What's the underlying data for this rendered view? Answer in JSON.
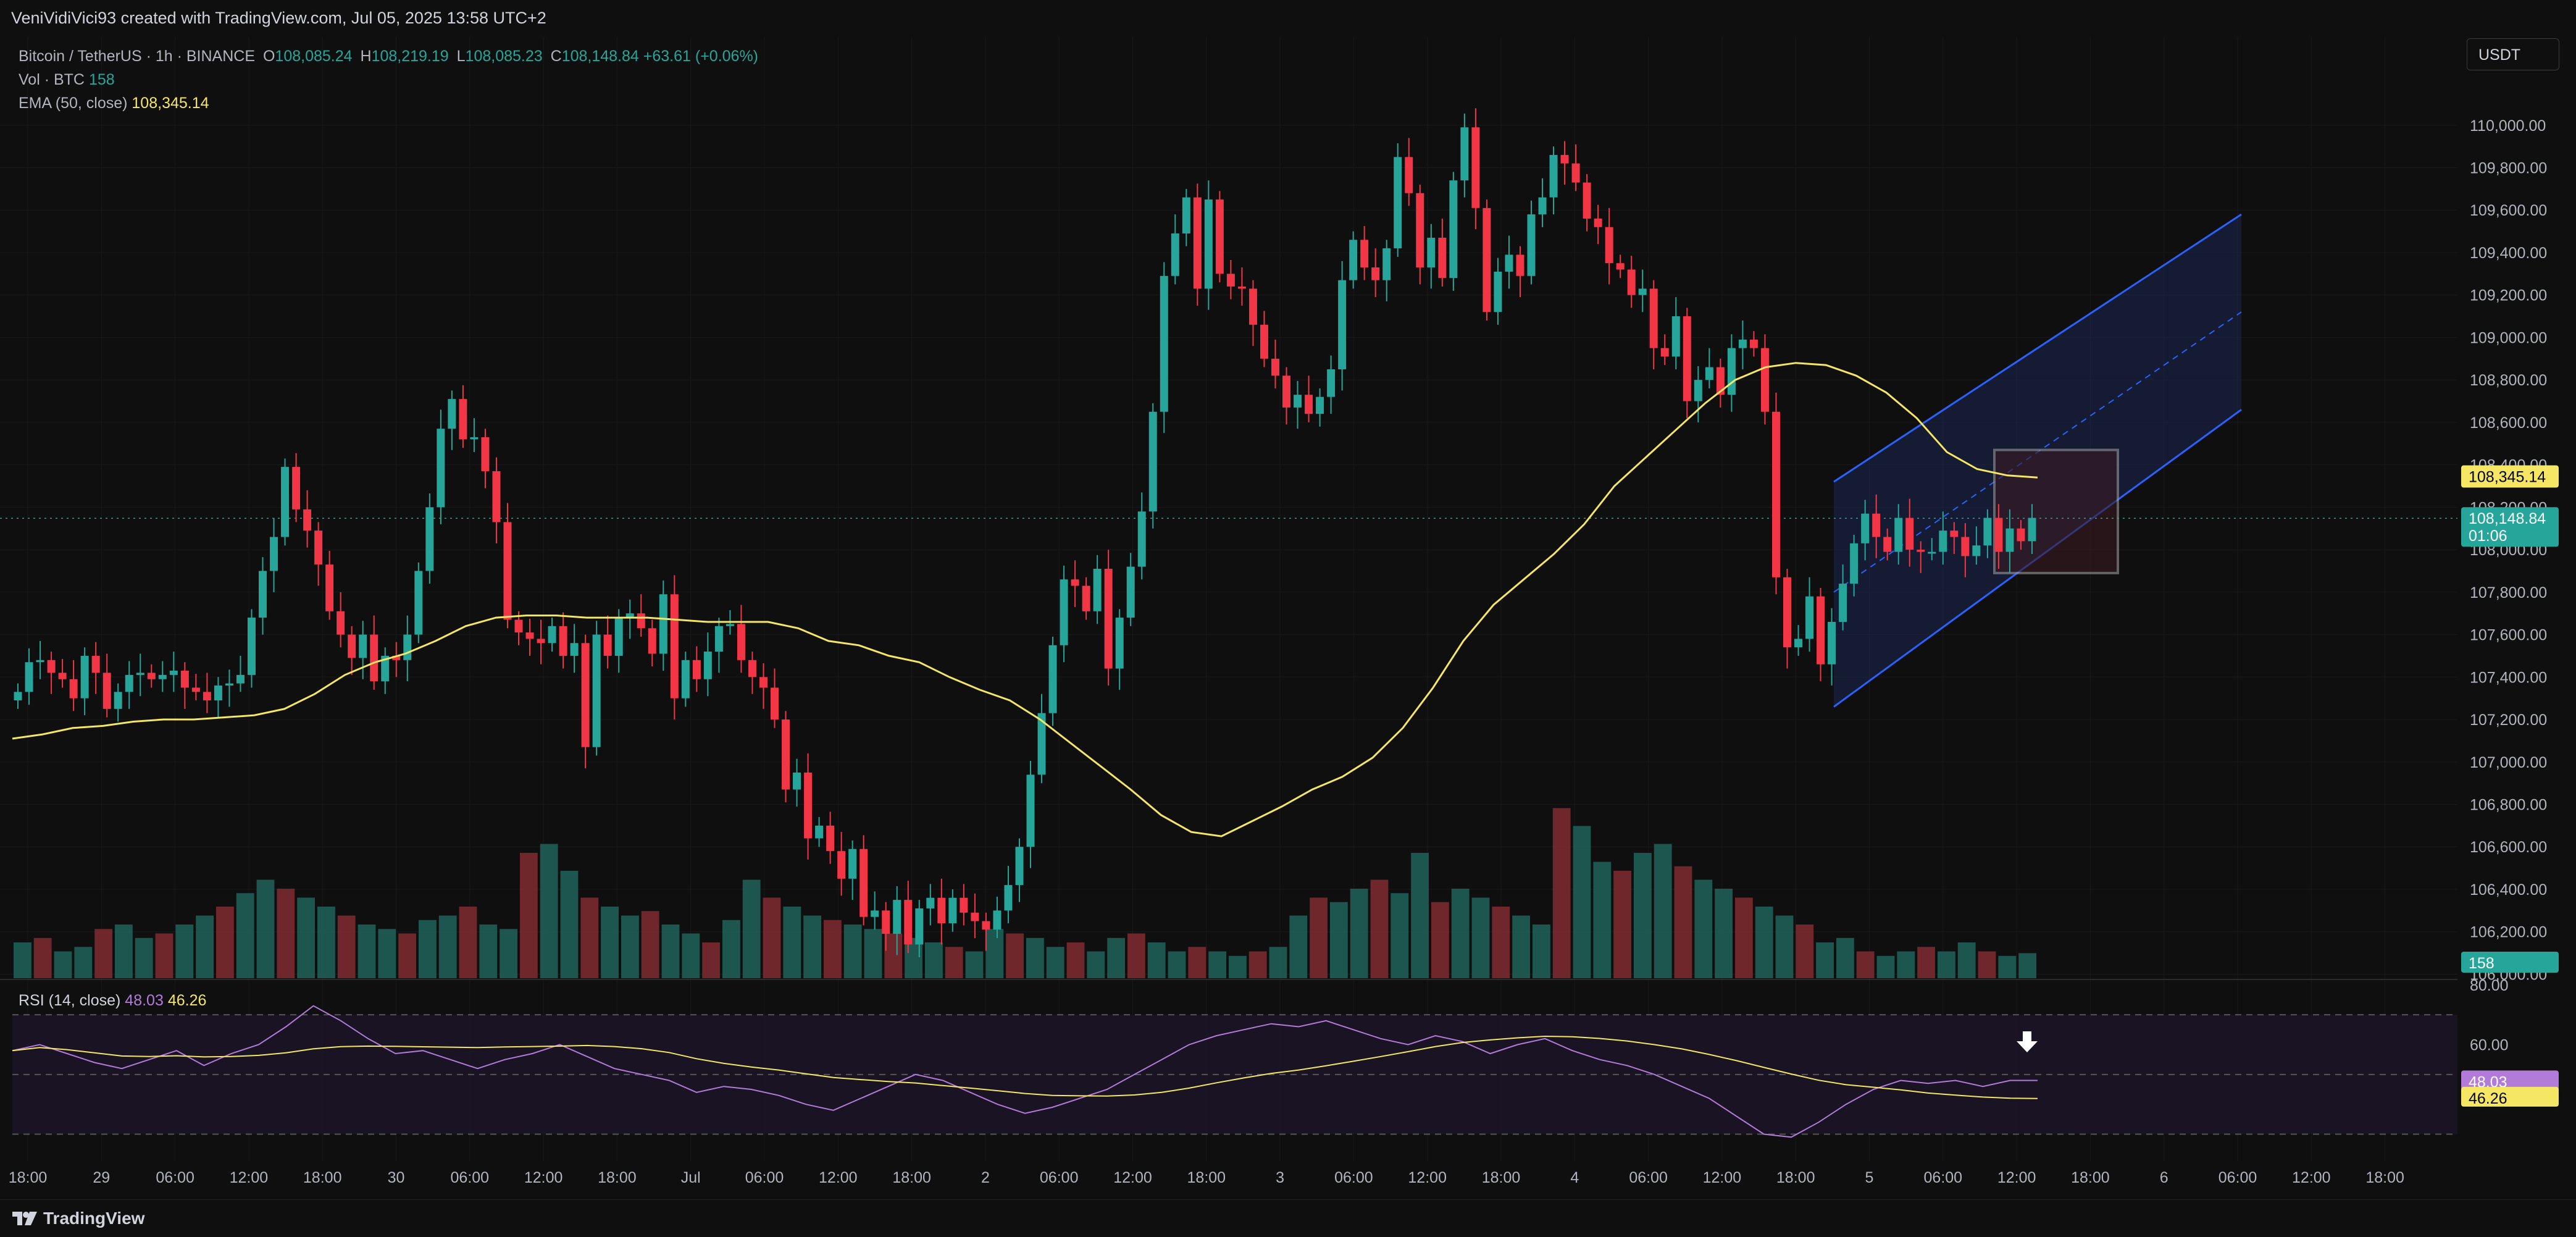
{
  "header": {
    "created_text": "VeniVidiVici93 created with TradingView.com, Jul 05, 2025 13:58 UTC+2"
  },
  "legend": {
    "symbol": "Bitcoin / TetherUS · 1h · BINANCE",
    "open_label": "O",
    "open": "108,085.24",
    "high_label": "H",
    "high": "108,219.19",
    "low_label": "L",
    "low": "108,085.23",
    "close_label": "C",
    "close": "108,148.84",
    "change": "+63.61 (+0.06%)",
    "vol_label": "Vol · BTC",
    "vol_value": "158",
    "ema_label": "EMA (50, close)",
    "ema_value": "108,345.14"
  },
  "currency": "USDT",
  "price_badges": {
    "ema": "108,345.14",
    "last": "108,148.84",
    "countdown": "01:06",
    "volume": "158"
  },
  "rsi": {
    "label": "RSI (14, close)",
    "value": "48.03",
    "ma_value": "46.26",
    "ticks": [
      "80.00",
      "60.00"
    ]
  },
  "footer": {
    "brand": "TradingView"
  },
  "colors": {
    "up": "#26a69a",
    "down": "#f23645",
    "ema": "#f5e663",
    "rsi": "#b37bd9",
    "rsi_ma": "#f5e663",
    "channel": "#2962ff",
    "background": "#0f0f0f"
  },
  "chart_data": {
    "type": "candlestick",
    "title": "Bitcoin / TetherUS · 1h · BINANCE",
    "ylim": [
      106000,
      110400
    ],
    "y_ticks": [
      "110,000.00",
      "109,800.00",
      "109,600.00",
      "109,400.00",
      "109,200.00",
      "109,000.00",
      "108,800.00",
      "108,600.00",
      "108,400.00",
      "108,200.00",
      "108,000.00",
      "107,800.00",
      "107,600.00",
      "107,400.00",
      "107,200.00",
      "107,000.00",
      "106,800.00",
      "106,600.00",
      "106,400.00",
      "106,200.00",
      "106,000.00"
    ],
    "x_ticks": [
      "18:00",
      "29",
      "06:00",
      "12:00",
      "18:00",
      "30",
      "06:00",
      "12:00",
      "18:00",
      "Jul",
      "06:00",
      "12:00",
      "18:00",
      "2",
      "06:00",
      "12:00",
      "18:00",
      "3",
      "06:00",
      "12:00",
      "18:00",
      "4",
      "06:00",
      "12:00",
      "18:00",
      "5",
      "06:00",
      "12:00",
      "18:00",
      "6",
      "06:00",
      "12:00",
      "18:00"
    ],
    "candles_close": [
      107330,
      107470,
      107480,
      107420,
      107390,
      107300,
      107500,
      107420,
      107250,
      107330,
      107410,
      107420,
      107390,
      107410,
      107430,
      107350,
      107330,
      107290,
      107360,
      107370,
      107410,
      107680,
      107900,
      108060,
      108390,
      108190,
      108090,
      107930,
      107710,
      107600,
      107490,
      107600,
      107380,
      107500,
      107480,
      107600,
      107900,
      108200,
      108570,
      108710,
      108520,
      108530,
      108370,
      108130,
      107670,
      107610,
      107580,
      107560,
      107640,
      107500,
      107560,
      107070,
      107600,
      107500,
      107680,
      107700,
      107630,
      107510,
      107790,
      107300,
      107480,
      107390,
      107520,
      107640,
      107650,
      107480,
      107400,
      107350,
      107200,
      106870,
      106950,
      106640,
      106700,
      106580,
      106450,
      106590,
      106270,
      106300,
      106190,
      106350,
      106140,
      106310,
      106360,
      106240,
      106360,
      106290,
      106250,
      106210,
      106300,
      106420,
      106600,
      106940,
      107230,
      107550,
      107860,
      107830,
      107710,
      107910,
      107440,
      107680,
      107920,
      108180,
      108650,
      109290,
      109490,
      109660,
      109230,
      109650,
      109300,
      109240,
      109230,
      109060,
      108900,
      108820,
      108670,
      108730,
      108640,
      108720,
      108850,
      109270,
      109460,
      109330,
      109270,
      109420,
      109850,
      109680,
      109330,
      109470,
      109280,
      109740,
      109990,
      109610,
      109120,
      109310,
      109390,
      109290,
      109580,
      109660,
      109860,
      109820,
      109730,
      109560,
      109520,
      109350,
      109320,
      109200,
      109230,
      108950,
      108910,
      109100,
      108700,
      108800,
      108860,
      108730,
      108950,
      108990,
      108950,
      108650,
      107870,
      107540,
      107580,
      107780,
      107460,
      107660,
      107840,
      108030,
      108170,
      108060,
      107990,
      108150,
      108000,
      107990,
      107990,
      108090,
      108060,
      107970,
      108020,
      108150,
      107990,
      108100,
      108040,
      108150
    ],
    "ema_50": [
      107110,
      107130,
      107160,
      107170,
      107190,
      107200,
      107200,
      107210,
      107220,
      107250,
      107320,
      107410,
      107470,
      107510,
      107570,
      107640,
      107680,
      107690,
      107690,
      107680,
      107680,
      107680,
      107670,
      107660,
      107660,
      107660,
      107630,
      107570,
      107550,
      107500,
      107470,
      107400,
      107340,
      107290,
      107200,
      107090,
      106980,
      106870,
      106750,
      106670,
      106650,
      106720,
      106790,
      106870,
      106930,
      107020,
      107160,
      107350,
      107570,
      107740,
      107860,
      107980,
      108120,
      108300,
      108430,
      108560,
      108690,
      108800,
      108860,
      108880,
      108870,
      108820,
      108740,
      108620,
      108460,
      108380,
      108350,
      108340
    ],
    "volume": [
      40,
      45,
      30,
      35,
      55,
      60,
      45,
      50,
      60,
      70,
      80,
      95,
      110,
      100,
      90,
      80,
      70,
      60,
      55,
      50,
      65,
      70,
      80,
      60,
      55,
      140,
      150,
      120,
      90,
      80,
      70,
      75,
      60,
      50,
      40,
      65,
      110,
      90,
      80,
      70,
      65,
      60,
      55,
      50,
      45,
      40,
      35,
      30,
      55,
      50,
      45,
      35,
      40,
      30,
      45,
      50,
      40,
      30,
      35,
      30,
      25,
      30,
      35,
      70,
      90,
      85,
      100,
      110,
      95,
      140,
      85,
      100,
      90,
      80,
      70,
      60,
      190,
      170,
      130,
      120,
      140,
      150,
      125,
      110,
      100,
      90,
      80,
      70,
      60,
      40,
      45,
      30,
      25,
      30,
      35,
      30,
      40,
      30,
      25,
      28
    ],
    "rsi": [
      58,
      60,
      57,
      54,
      52,
      55,
      58,
      53,
      57,
      60,
      66,
      73,
      68,
      62,
      57,
      58,
      55,
      52,
      55,
      57,
      60,
      56,
      52,
      50,
      48,
      44,
      46,
      45,
      43,
      40,
      38,
      42,
      46,
      50,
      48,
      44,
      40,
      37,
      39,
      42,
      45,
      50,
      55,
      60,
      63,
      65,
      67,
      66,
      68,
      65,
      62,
      60,
      63,
      61,
      57,
      60,
      62,
      58,
      55,
      53,
      50,
      46,
      42,
      36,
      30,
      29,
      34,
      40,
      45,
      48,
      47,
      48,
      46,
      48,
      48
    ]
  }
}
